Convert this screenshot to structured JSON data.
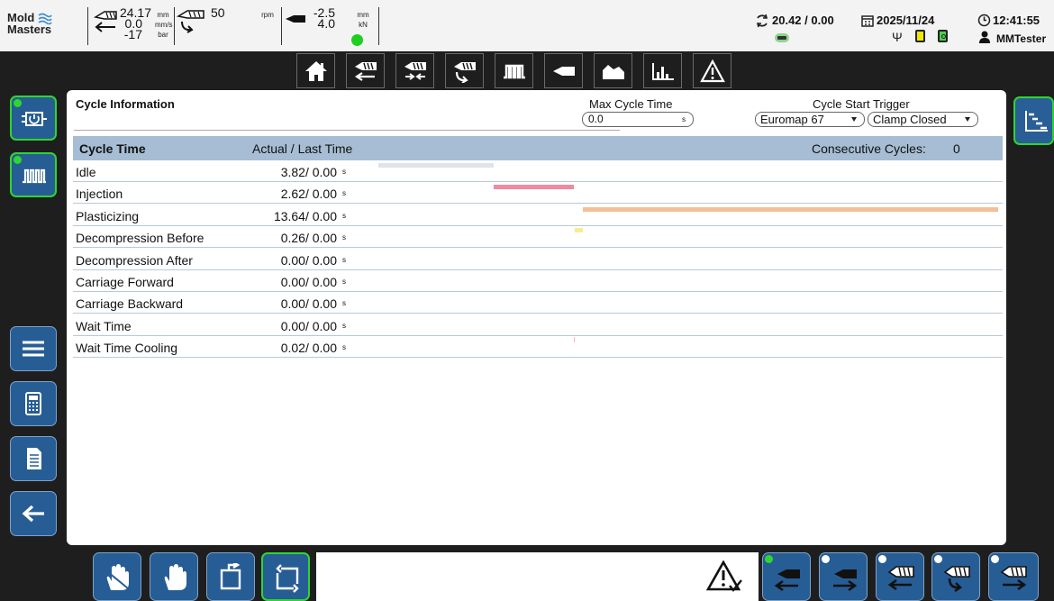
{
  "header": {
    "logo": {
      "line1": "Mold",
      "line2": "Masters"
    },
    "injection": {
      "position": "24.17",
      "velocity": "0.0",
      "pressure": "-17",
      "units": [
        "mm",
        "mm/s",
        "bar"
      ]
    },
    "screw": {
      "speed": "50",
      "unit": "rpm"
    },
    "carriage": {
      "position": "-2.5",
      "force": "4.0",
      "units": [
        "mm",
        "kN"
      ]
    },
    "cycle": "20.42 / 0.00",
    "date": "2025/11/24",
    "time": "12:41:55",
    "user": "MMTester"
  },
  "nav": [
    "home-icon",
    "injection-icon",
    "injection-retract-icon",
    "screw-rotate-icon",
    "heater-icon",
    "carriage-icon",
    "mountain-chart-icon",
    "bar-chart-icon",
    "warning-icon"
  ],
  "panel": {
    "title": "Cycle Information",
    "max_cycle_time": {
      "label": "Max Cycle Time",
      "value": "0.0",
      "unit": "s"
    },
    "trigger": {
      "label": "Cycle Start Trigger",
      "source": "Euromap 67",
      "event": "Clamp Closed"
    },
    "table": {
      "col_name": "Cycle Time",
      "col_time": "Actual / Last Time",
      "consecutive_label": "Consecutive Cycles:",
      "consecutive_value": "0",
      "unit": "s",
      "rows": [
        {
          "label": "Idle",
          "time": "3.82/ 0.00"
        },
        {
          "label": "Injection",
          "time": "2.62/ 0.00"
        },
        {
          "label": "Plasticizing",
          "time": "13.64/ 0.00"
        },
        {
          "label": "Decompression Before",
          "time": "0.26/ 0.00"
        },
        {
          "label": "Decompression After",
          "time": "0.00/ 0.00"
        },
        {
          "label": "Carriage Forward",
          "time": "0.00/ 0.00"
        },
        {
          "label": "Carriage Backward",
          "time": "0.00/ 0.00"
        },
        {
          "label": "Wait Time",
          "time": "0.00/ 0.00"
        },
        {
          "label": "Wait Time Cooling",
          "time": "0.02/ 0.00"
        }
      ]
    }
  },
  "colors": {
    "idle": "#dfe3ea",
    "injection": "#ee8aa3",
    "plasticizing": "#f4bf95",
    "decompression": "#f5ec93",
    "wait_cooling": "#f4b9c6",
    "accent_green": "#2fd62f",
    "button_blue": "#275d95"
  }
}
